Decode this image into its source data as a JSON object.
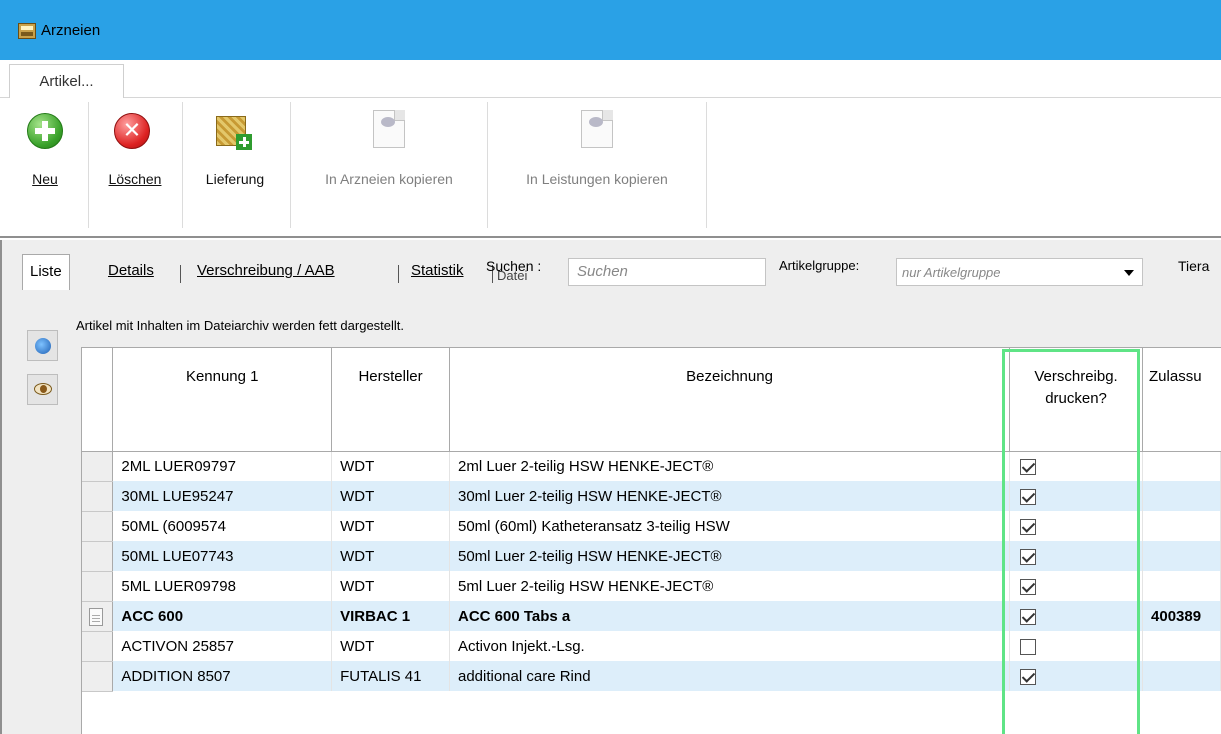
{
  "window": {
    "title": "Arzneien"
  },
  "ribbon": {
    "tab": "Artikel...",
    "buttons": {
      "neu": "Neu",
      "loeschen": "Löschen",
      "lieferung": "Lieferung",
      "in_arzneien": "In Arzneien kopieren",
      "in_leistungen": "In Leistungen kopieren"
    }
  },
  "tabs": {
    "liste": "Liste",
    "details": "Details",
    "verschreibung": "Verschreibung / AAB",
    "statistik": "Statistik",
    "dateien_partial": "Datei"
  },
  "search": {
    "label": "Suchen :",
    "placeholder": "Suchen"
  },
  "artikelgruppe": {
    "label": "Artikelgruppe:",
    "placeholder": "nur Artikelgruppe"
  },
  "tiera_label": "Tiera",
  "info": "Artikel mit Inhalten im Dateiarchiv werden fett dargestellt.",
  "columns": {
    "kennung": "Kennung 1",
    "hersteller": "Hersteller",
    "bezeichnung": "Bezeichnung",
    "verschreibg": "Verschreibg. drucken?",
    "zulassung": "Zulassu"
  },
  "rows": [
    {
      "kennung": "2ML LUER09797",
      "hersteller": "WDT",
      "bezeichnung": "2ml Luer 2-teilig HSW HENKE-JECT®",
      "drucken": true,
      "zulassung": ""
    },
    {
      "kennung": "30ML LUE95247",
      "hersteller": "WDT",
      "bezeichnung": "30ml Luer 2-teilig HSW HENKE-JECT®",
      "drucken": true,
      "zulassung": ""
    },
    {
      "kennung": "50ML (6009574",
      "hersteller": "WDT",
      "bezeichnung": "50ml (60ml) Katheteransatz 3-teilig HSW",
      "drucken": true,
      "zulassung": ""
    },
    {
      "kennung": "50ML LUE07743",
      "hersteller": "WDT",
      "bezeichnung": "50ml Luer 2-teilig HSW HENKE-JECT®",
      "drucken": true,
      "zulassung": ""
    },
    {
      "kennung": "5ML LUER09798",
      "hersteller": "WDT",
      "bezeichnung": "5ml Luer 2-teilig HSW HENKE-JECT®",
      "drucken": true,
      "zulassung": ""
    },
    {
      "kennung": "ACC 600",
      "hersteller": "VIRBAC 1",
      "bezeichnung": "ACC 600 Tabs a",
      "drucken": true,
      "zulassung": "400389"
    },
    {
      "kennung": "ACTIVON 25857",
      "hersteller": "WDT",
      "bezeichnung": "Activon Injekt.-Lsg.",
      "drucken": false,
      "zulassung": ""
    },
    {
      "kennung": "ADDITION 8507",
      "hersteller": "FUTALIS 41",
      "bezeichnung": "additional care Rind",
      "drucken": true,
      "zulassung": ""
    }
  ],
  "colors": {
    "titlebar": "#2aa1e6",
    "row_alt": "#ddeefa",
    "highlight": "#5fe486"
  }
}
